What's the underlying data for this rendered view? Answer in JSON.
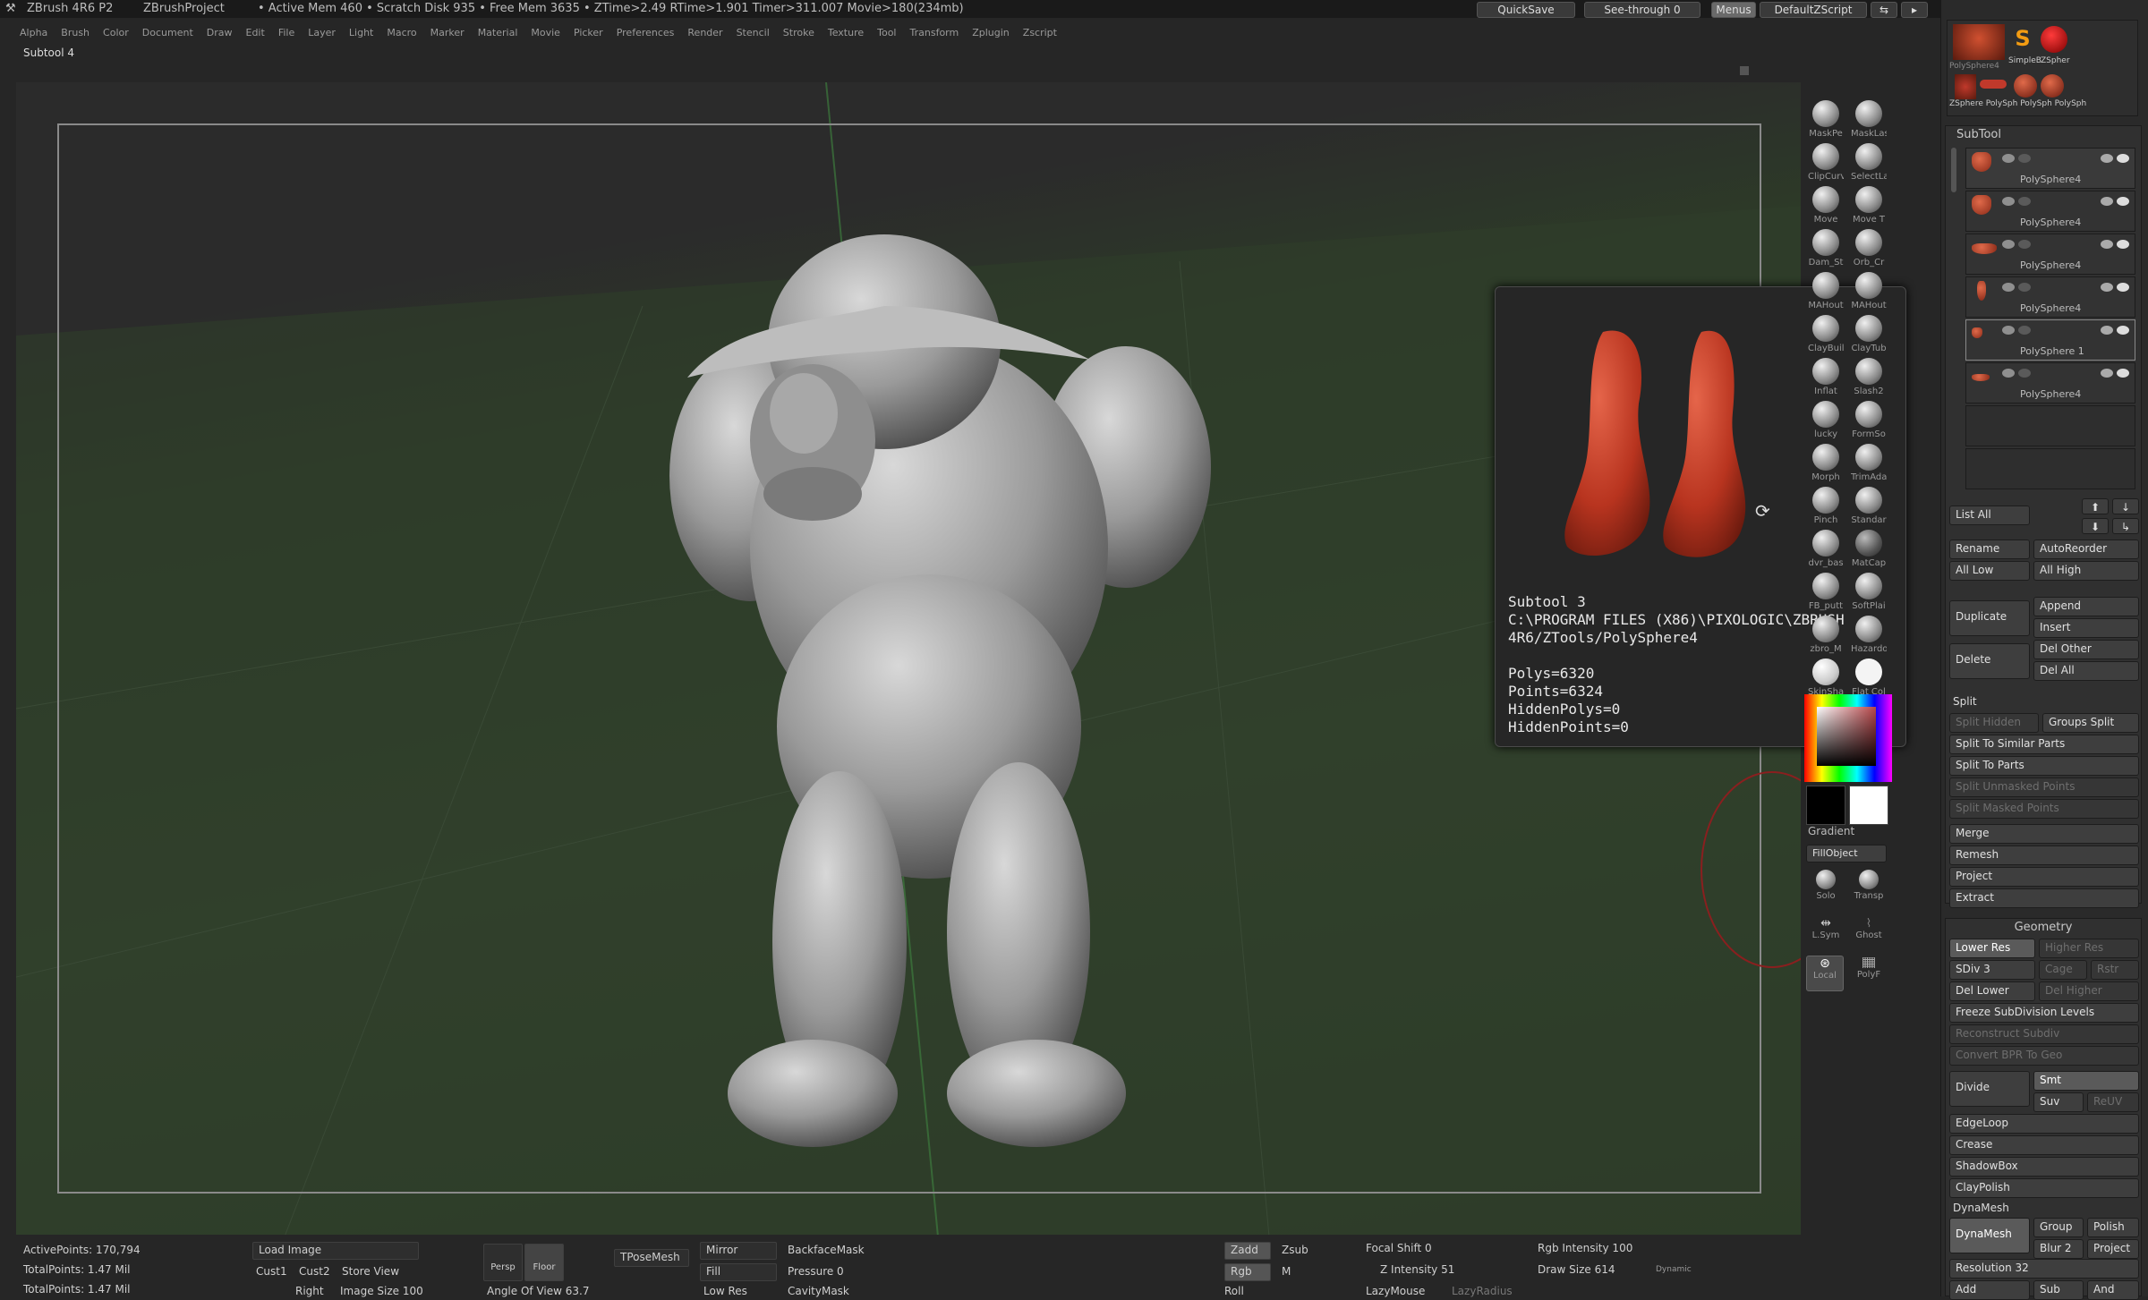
{
  "titlebar": {
    "app": "ZBrush 4R6 P2",
    "project": "ZBrushProject",
    "stats": "• Active Mem 460 • Scratch Disk 935 • Free Mem 3635 • ZTime>2.49 RTime>1.901 Timer>311.007 Movie>180(234mb)",
    "quicksave": "QuickSave",
    "seethrough": "See-through 0",
    "menus": "Menus",
    "script": "DefaultZScript"
  },
  "menubar": [
    "Alpha",
    "Brush",
    "Color",
    "Document",
    "Draw",
    "Edit",
    "File",
    "Layer",
    "Light",
    "Macro",
    "Marker",
    "Material",
    "Movie",
    "Picker",
    "Preferences",
    "Render",
    "Stencil",
    "Stroke",
    "Texture",
    "Tool",
    "Transform",
    "Zplugin",
    "Zscript"
  ],
  "subtool_label": "Subtool 4",
  "brushes": [
    [
      "MaskPe",
      "MaskLas"
    ],
    [
      "ClipCurv",
      "SelectLa"
    ],
    [
      "Move",
      "Move T"
    ],
    [
      "Dam_St",
      "Orb_Cr"
    ],
    [
      "MAHout",
      "MAHout"
    ],
    [
      "ClayBuil",
      "ClayTub"
    ],
    [
      "Inflat",
      "Slash2"
    ],
    [
      "lucky",
      "FormSo"
    ],
    [
      "Morph",
      "TrimAda"
    ],
    [
      "Pinch",
      "Standar"
    ],
    [
      "dvr_bas",
      "MatCap"
    ],
    [
      "FB_putt",
      "SoftPlai"
    ],
    [
      "zbro_M",
      "Hazardo"
    ],
    [
      "SkinSha",
      "Flat Col"
    ]
  ],
  "palette": {
    "gradient": "Gradient",
    "fillobject": "FillObject",
    "solo": "Solo",
    "transp": "Transp",
    "lsym": "L.Sym",
    "ghost": "Ghost",
    "local": "Local",
    "polyf": "PolyF"
  },
  "popup": {
    "title": "Subtool 3",
    "path1": "C:\\PROGRAM FILES (X86)\\PIXOLOGIC\\ZBRUSH",
    "path2": "4R6/ZTools/PolySphere4",
    "polys": "Polys=6320",
    "points": "Points=6324",
    "hiddenpolys": "HiddenPolys=0",
    "hiddenpoints": "HiddenPoints=0"
  },
  "rightpanel": {
    "thumb_labels": [
      "PolySphere4",
      "SimpleB",
      "ZSpher",
      "ZSphere",
      "PolySph",
      "PolySph",
      "PolySph"
    ],
    "subtool_title": "SubTool",
    "subtools": [
      "PolySphere4",
      "PolySphere4",
      "PolySphere4",
      "PolySphere4",
      "PolySphere 1",
      "PolySphere4"
    ],
    "list_all": "List All",
    "rename": "Rename",
    "autoreorder": "AutoReorder",
    "all_low": "All Low",
    "all_high": "All High",
    "duplicate": "Duplicate",
    "append": "Append",
    "insert": "Insert",
    "delete": "Delete",
    "del_other": "Del Other",
    "del_all": "Del All",
    "split": "Split",
    "split_hidden": "Split Hidden",
    "groups_split": "Groups Split",
    "split_similar": "Split To Similar Parts",
    "split_parts": "Split To Parts",
    "split_unmasked": "Split Unmasked Points",
    "split_masked": "Split Masked Points",
    "merge": "Merge",
    "remesh": "Remesh",
    "project": "Project",
    "extract": "Extract",
    "geometry": "Geometry",
    "lower_res": "Lower Res",
    "higher_res": "Higher Res",
    "sdiv": "SDiv 3",
    "cage": "Cage",
    "rstr": "Rstr",
    "del_lower": "Del Lower",
    "del_higher": "Del Higher",
    "freeze": "Freeze SubDivision Levels",
    "reconstruct": "Reconstruct Subdiv",
    "convert_bpr": "Convert BPR To Geo",
    "divide": "Divide",
    "smt": "Smt",
    "suv": "Suv",
    "reuv": "ReUV",
    "edgeloop": "EdgeLoop",
    "crease": "Crease",
    "shadowbox": "ShadowBox",
    "claypolish": "ClayPolish",
    "dynamesh_title": "DynaMesh",
    "dynamesh": "DynaMesh",
    "group": "Group",
    "polish": "Polish",
    "blur": "Blur 2",
    "project2": "Project",
    "resolution": "Resolution 32",
    "add": "Add",
    "sub": "Sub",
    "and": "And"
  },
  "bottombar": {
    "activepoints": "ActivePoints: 170,794",
    "totalpoints": "TotalPoints: 1.47 Mil",
    "totalpoints2": "TotalPoints: 1.47 Mil",
    "load_image": "Load Image",
    "cust1": "Cust1",
    "cust2": "Cust2",
    "store_view": "Store View",
    "right_image": "Right",
    "image_size": "Image Size 100",
    "persp": "Persp",
    "floor": "Floor",
    "tposemesh": "TPoseMesh",
    "mirror": "Mirror",
    "backfacemask": "BackfaceMask",
    "fill": "Fill",
    "pressure": "Pressure 0",
    "lowres": "Low Res",
    "cavitymask": "CavityMask",
    "angle_view": "Angle Of View 63.7",
    "zadd": "Zadd",
    "zsub": "Zsub",
    "rgb": "Rgb",
    "m": "M",
    "roll": "Roll",
    "focal": "Focal Shift 0",
    "zintensity": "Z Intensity 51",
    "lazymouse": "LazyMouse",
    "lazyradius": "LazyRadius",
    "rgbint": "Rgb Intensity 100",
    "drawsize": "Draw Size 614",
    "dynamic": "Dynamic"
  },
  "colors": {
    "accent": "#c0392b",
    "ui_bg": "#2a2a2a"
  }
}
